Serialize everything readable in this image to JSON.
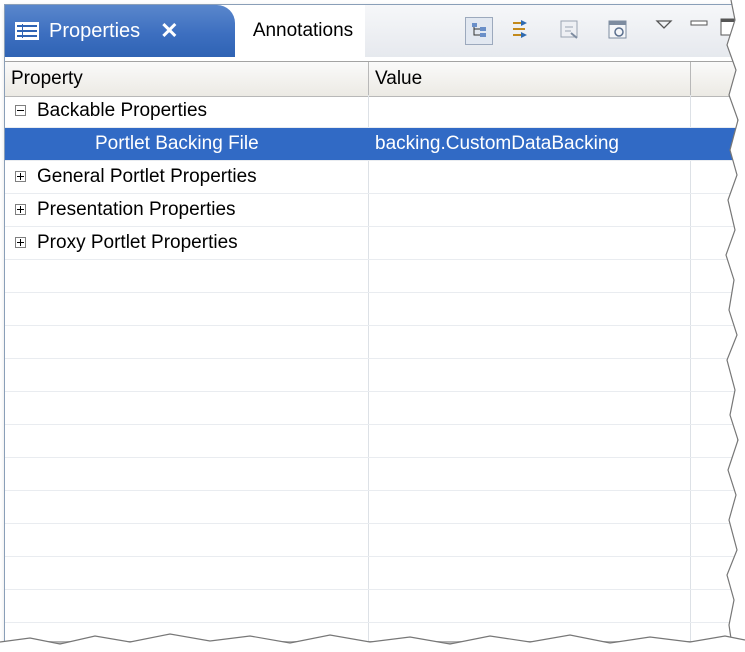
{
  "tabs": {
    "active_label": "Properties",
    "inactive_label": "Annotations"
  },
  "icons": {
    "tab_icon": "properties-view-icon",
    "close": "close-icon",
    "toolbar": [
      "show-categories-icon",
      "show-advanced-icon",
      "restore-default-icon",
      "defaults-icon",
      "view-menu-icon",
      "minimize-icon",
      "maximize-icon"
    ]
  },
  "colors": {
    "tab_active": "#3d6fc0",
    "selection": "#316ac5"
  },
  "table": {
    "headers": {
      "property": "Property",
      "value": "Value"
    },
    "rows": [
      {
        "property": "Backable Properties",
        "value": "",
        "expander": "minus"
      },
      {
        "property": "Portlet Backing File",
        "value": "backing.CustomDataBacking",
        "selected": true
      },
      {
        "property": "General Portlet Properties",
        "value": "",
        "expander": "plus"
      },
      {
        "property": "Presentation Properties",
        "value": "",
        "expander": "plus"
      },
      {
        "property": "Proxy Portlet Properties",
        "value": "",
        "expander": "plus"
      }
    ]
  }
}
